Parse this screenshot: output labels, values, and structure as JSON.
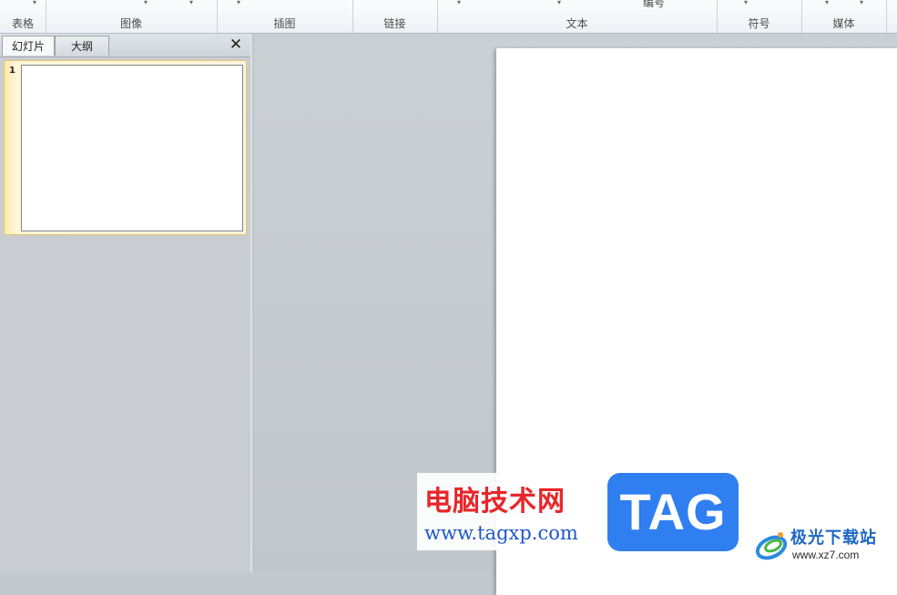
{
  "ribbon": {
    "groups": [
      {
        "label": "表格"
      },
      {
        "label": "图像"
      },
      {
        "label": "插图"
      },
      {
        "label": "链接"
      },
      {
        "label": "文本",
        "cut_label": "编号"
      },
      {
        "label": "符号"
      },
      {
        "label": "媒体"
      }
    ]
  },
  "pane": {
    "tabs": [
      {
        "label": "幻灯片",
        "active": true
      },
      {
        "label": "大纲",
        "active": false
      }
    ],
    "close_glyph": "✕",
    "slides": [
      {
        "number": "1",
        "selected": true
      }
    ]
  },
  "watermarks": {
    "site_cn": "电脑技术网",
    "site_url": "www.tagxp.com",
    "tag_badge": "TAG",
    "xz_cn": "极光下载站",
    "xz_url": "www.xz7.com"
  },
  "colors": {
    "selection_gold": "#e6c56b",
    "watermark_red": "#e8262a",
    "watermark_blue": "#1f57c8",
    "tag_blue": "#2f7ff1"
  }
}
